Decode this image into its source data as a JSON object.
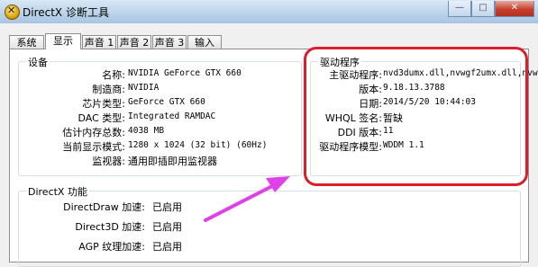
{
  "window": {
    "title": "DirectX 诊断工具",
    "minimize": "—",
    "maximize": "□",
    "close": "✕"
  },
  "tabs": [
    "系统",
    "显示",
    "声音 1",
    "声音 2",
    "声音 3",
    "输入"
  ],
  "device": {
    "heading": "设备",
    "rows": [
      {
        "label": "名称:",
        "value": "NVIDIA GeForce GTX 660"
      },
      {
        "label": "制造商:",
        "value": "NVIDIA"
      },
      {
        "label": "芯片类型:",
        "value": "GeForce GTX 660"
      },
      {
        "label": "DAC 类型:",
        "value": "Integrated RAMDAC"
      },
      {
        "label": "估计内存总数:",
        "value": "4038 MB"
      },
      {
        "label": "当前显示模式:",
        "value": "1280 x 1024 (32 bit) (60Hz)"
      },
      {
        "label": "监视器:",
        "value": "通用即插即用监视器"
      }
    ]
  },
  "driver": {
    "heading": "驱动程序",
    "rows": [
      {
        "label": "主驱动程序:",
        "value": "nvd3dumx.dll,nvwgf2umx.dll,nvw"
      },
      {
        "label": "版本:",
        "value": "9.18.13.3788"
      },
      {
        "label": "日期:",
        "value": "2014/5/20 10:44:03"
      },
      {
        "label": "WHQL 签名:",
        "value": "暂缺"
      },
      {
        "label": "DDI 版本:",
        "value": "11"
      },
      {
        "label": "驱动程序模型:",
        "value": "WDDM 1.1"
      }
    ]
  },
  "features": {
    "heading": "DirectX 功能",
    "rows": [
      {
        "label": "DirectDraw 加速:",
        "value": "已启用"
      },
      {
        "label": "Direct3D 加速:",
        "value": "已启用"
      },
      {
        "label": "AGP 纹理加速:",
        "value": "已启用"
      }
    ]
  },
  "annotation": {
    "color": "#dc1d2b",
    "arrow_color": "#e040e8"
  }
}
